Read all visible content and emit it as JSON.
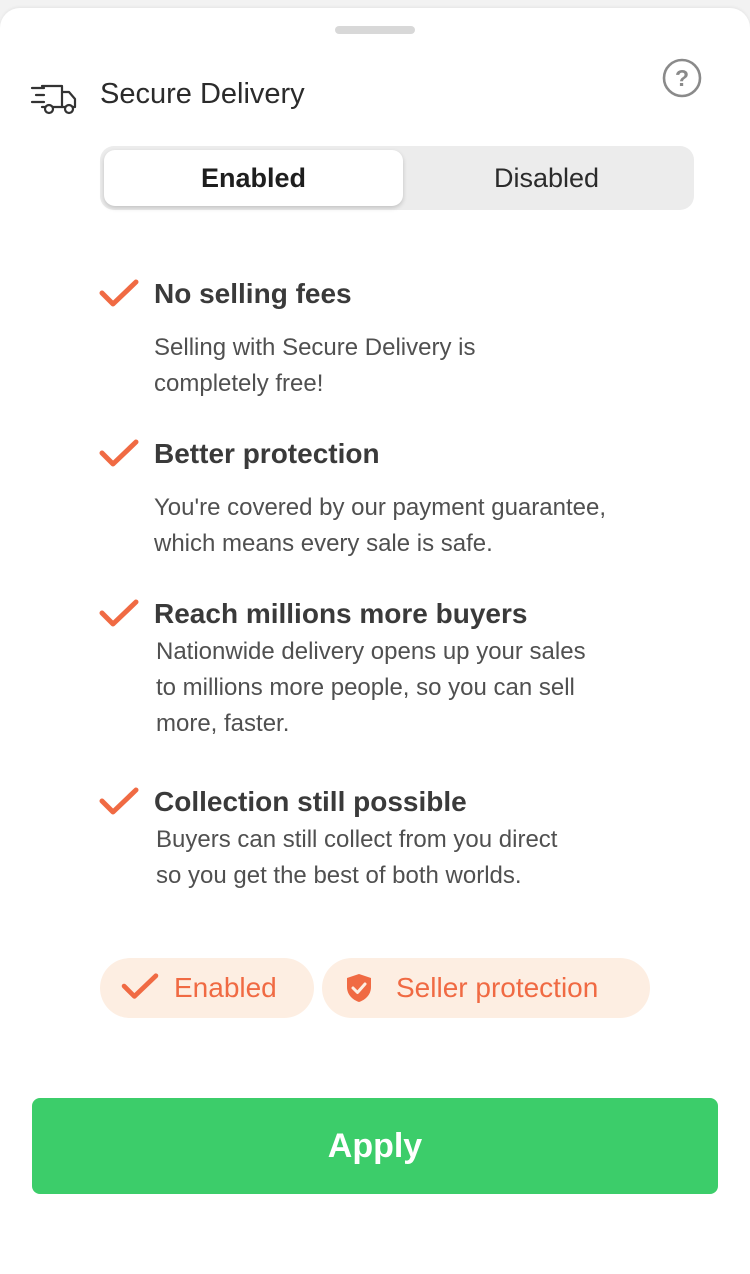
{
  "header": {
    "title": "Secure Delivery",
    "icon": "delivery-truck-icon",
    "help_icon": "help-icon"
  },
  "toggle": {
    "options": [
      "Enabled",
      "Disabled"
    ],
    "selected": "Enabled"
  },
  "features": [
    {
      "title": "No selling fees",
      "lines": [
        "Selling with Secure Delivery is",
        "completely free!"
      ]
    },
    {
      "title": "Better protection",
      "lines": [
        "You're covered by our payment guarantee,",
        "which means every sale is safe."
      ]
    },
    {
      "title": "Reach millions more buyers",
      "lines": [
        "Nationwide delivery opens up your sales",
        "to millions more people, so you can sell",
        "more, faster."
      ]
    },
    {
      "title": "Collection still possible",
      "lines": [
        "Buyers can still collect from you direct",
        "so you get the best of both worlds."
      ]
    }
  ],
  "chips": {
    "enabled": "Enabled",
    "seller": "Seller protection"
  },
  "apply_label": "Apply",
  "colors": {
    "accent": "#f06a43",
    "chip_bg": "#fdeee2",
    "apply": "#3ccd6a"
  }
}
